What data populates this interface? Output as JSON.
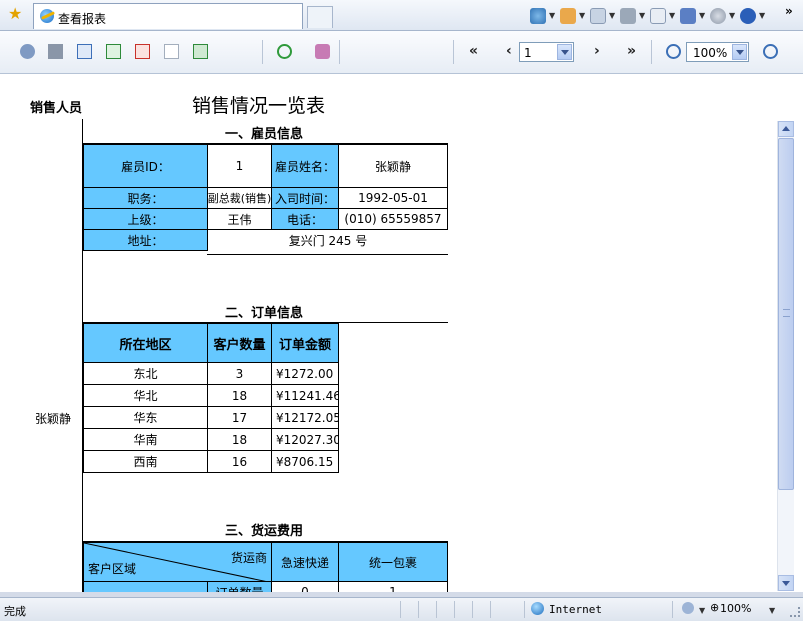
{
  "browser": {
    "tab_title": "查看报表",
    "status_text": "完成",
    "zone_text": "Internet",
    "zoom_status": "100%"
  },
  "toolbar": {
    "page_number": "1",
    "zoom_level": "100%",
    "first_label": "«",
    "prev_label": "‹",
    "next_label": "›",
    "last_label": "»"
  },
  "report": {
    "left_header": "销售人员",
    "title": "销售情况一览表",
    "salesperson": "张颖静",
    "section1_title": "一、雇员信息",
    "employee": {
      "id_label": "雇员ID：",
      "id_value": "1",
      "name_label": "雇员姓名：",
      "name_value": "张颖静",
      "title_label": "职务：",
      "title_value": "副总裁(销售)",
      "hire_label": "入司时间：",
      "hire_value": "1992-05-01",
      "boss_label": "上级：",
      "boss_value": "王伟",
      "phone_label": "电话：",
      "phone_value": "(010) 65559857",
      "address_label": "地址：",
      "address_value": "复兴门 245 号"
    },
    "section2_title": "二、订单信息",
    "orders": {
      "headers": [
        "所在地区",
        "客户数量",
        "订单金额"
      ],
      "rows": [
        {
          "region": "东北",
          "customers": "3",
          "amount": "¥1272.00"
        },
        {
          "region": "华北",
          "customers": "18",
          "amount": "¥11241.46"
        },
        {
          "region": "华东",
          "customers": "17",
          "amount": "¥12172.05"
        },
        {
          "region": "华南",
          "customers": "18",
          "amount": "¥12027.30"
        },
        {
          "region": "西南",
          "customers": "16",
          "amount": "¥8706.15"
        }
      ]
    },
    "section3_title": "三、货运费用",
    "freight": {
      "corner_top": "货运商",
      "corner_bottom": "客户区域",
      "col1": "急速快递",
      "col2": "统一包裹",
      "sub_label": "订单数量",
      "sub_v1": "0",
      "sub_v2": "1"
    }
  }
}
